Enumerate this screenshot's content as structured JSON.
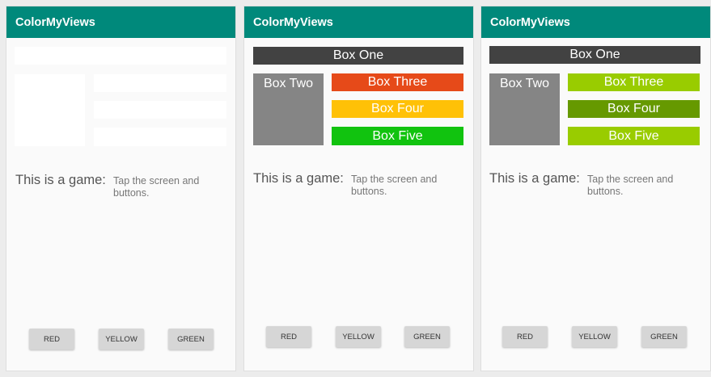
{
  "screens": [
    {
      "app_title": "ColorMyViews",
      "boxes": {
        "one": {
          "label": "",
          "color": "#ffffff"
        },
        "two": {
          "label": "",
          "color": "#ffffff"
        },
        "three": {
          "label": "",
          "color": "#ffffff"
        },
        "four": {
          "label": "",
          "color": "#ffffff"
        },
        "five": {
          "label": "",
          "color": "#ffffff"
        }
      },
      "game_label": "This is a game:",
      "game_description": "Tap the screen and buttons.",
      "buttons": {
        "red": "RED",
        "yellow": "YELLOW",
        "green": "GREEN"
      }
    },
    {
      "app_title": "ColorMyViews",
      "boxes": {
        "one": {
          "label": "Box One",
          "color": "#424242"
        },
        "two": {
          "label": "Box Two",
          "color": "#858585"
        },
        "three": {
          "label": "Box Three",
          "color": "#e64a19"
        },
        "four": {
          "label": "Box Four",
          "color": "#ffc107"
        },
        "five": {
          "label": "Box Five",
          "color": "#11c30f"
        }
      },
      "game_label": "This is a game:",
      "game_description": "Tap the screen and buttons.",
      "buttons": {
        "red": "RED",
        "yellow": "YELLOW",
        "green": "GREEN"
      }
    },
    {
      "app_title": "ColorMyViews",
      "boxes": {
        "one": {
          "label": "Box One",
          "color": "#424242"
        },
        "two": {
          "label": "Box Two",
          "color": "#858585"
        },
        "three": {
          "label": "Box Three",
          "color": "#99cc00"
        },
        "four": {
          "label": "Box Four",
          "color": "#669900"
        },
        "five": {
          "label": "Box Five",
          "color": "#99cc00"
        }
      },
      "game_label": "This is a game:",
      "game_description": "Tap the screen and buttons.",
      "buttons": {
        "red": "RED",
        "yellow": "YELLOW",
        "green": "GREEN"
      }
    }
  ]
}
